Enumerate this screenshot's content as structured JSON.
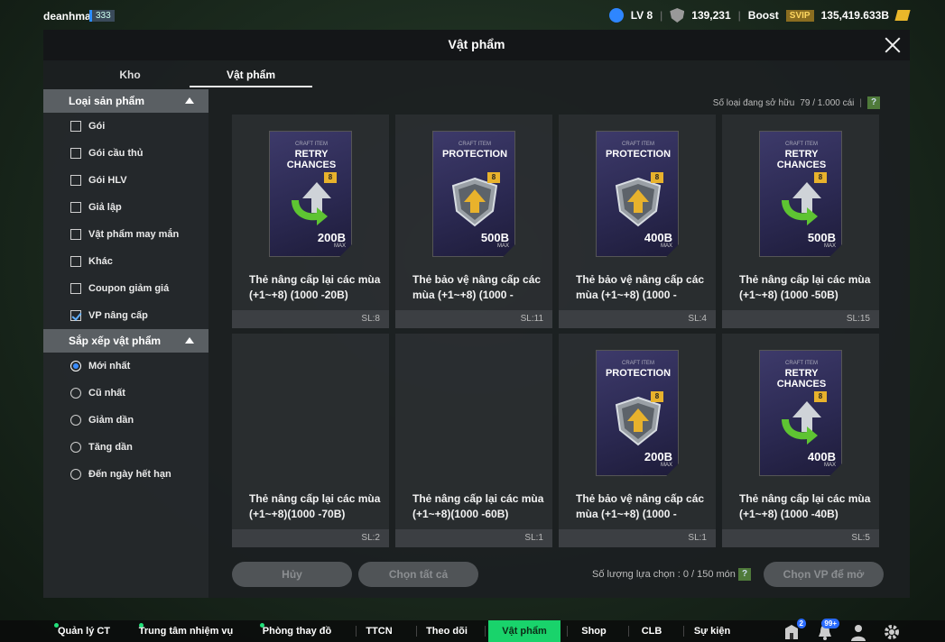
{
  "topbar": {
    "username": "deanhma",
    "user_badge": "333",
    "level": "LV 8",
    "shield_value": "139,231",
    "boost_label": "Boost",
    "svip_label": "SVIP",
    "bp_value": "135,419.633B"
  },
  "modal": {
    "title": "Vật phẩm",
    "tabs": [
      {
        "label": "Kho",
        "active": false
      },
      {
        "label": "Vật phẩm",
        "active": true
      }
    ]
  },
  "sidebar": {
    "product_type_header": "Loại sản phẩm",
    "filters": [
      {
        "label": "Gói",
        "checked": false
      },
      {
        "label": "Gói cầu thủ",
        "checked": false
      },
      {
        "label": "Gói HLV",
        "checked": false
      },
      {
        "label": "Giả lập",
        "checked": false
      },
      {
        "label": "Vật phẩm may mắn",
        "checked": false
      },
      {
        "label": "Khác",
        "checked": false
      },
      {
        "label": "Coupon giảm giá",
        "checked": false
      },
      {
        "label": "VP nâng cấp",
        "checked": true
      }
    ],
    "sort_header": "Sắp xếp vật phẩm",
    "sorts": [
      {
        "label": "Mới nhất",
        "selected": true
      },
      {
        "label": "Cũ nhất",
        "selected": false
      },
      {
        "label": "Giảm dần",
        "selected": false
      },
      {
        "label": "Tăng dần",
        "selected": false
      },
      {
        "label": "Đến ngày hết hạn",
        "selected": false
      }
    ]
  },
  "owned": {
    "label": "Số loại đang sở hữu",
    "value": "79 / 1.000 cái"
  },
  "items": [
    {
      "kind": "retry",
      "tag": "CRAFT ITEM",
      "title": "RETRY CHANCES",
      "level": "8",
      "value": "200B",
      "max": "MAX",
      "name": "Thẻ nâng cấp lại các mùa (+1~+8) (1000 -20B)",
      "qty": "SL:8",
      "show_card": true
    },
    {
      "kind": "protect",
      "tag": "CRAFT ITEM",
      "title": "PROTECTION",
      "level": "8",
      "value": "500B",
      "max": "MAX",
      "name": "Thẻ bảo vệ nâng cấp các mùa (+1~+8) (1000 -",
      "qty": "SL:11",
      "show_card": true
    },
    {
      "kind": "protect",
      "tag": "CRAFT ITEM",
      "title": "PROTECTION",
      "level": "8",
      "value": "400B",
      "max": "MAX",
      "name": "Thẻ bảo vệ nâng cấp các mùa (+1~+8) (1000 -",
      "qty": "SL:4",
      "show_card": true
    },
    {
      "kind": "retry",
      "tag": "CRAFT ITEM",
      "title": "RETRY CHANCES",
      "level": "8",
      "value": "500B",
      "max": "MAX",
      "name": "Thẻ nâng cấp lại các mùa (+1~+8) (1000 -50B)",
      "qty": "SL:15",
      "show_card": true
    },
    {
      "kind": "retry",
      "tag": "",
      "title": "",
      "level": "",
      "value": "",
      "max": "",
      "name": "Thẻ nâng cấp lại các mùa (+1~+8)(1000 -70B)",
      "qty": "SL:2",
      "show_card": false
    },
    {
      "kind": "retry",
      "tag": "",
      "title": "",
      "level": "",
      "value": "",
      "max": "",
      "name": "Thẻ nâng cấp lại các mùa (+1~+8)(1000 -60B)",
      "qty": "SL:1",
      "show_card": false
    },
    {
      "kind": "protect",
      "tag": "CRAFT ITEM",
      "title": "PROTECTION",
      "level": "8",
      "value": "200B",
      "max": "MAX",
      "name": "Thẻ bảo vệ nâng cấp các mùa (+1~+8) (1000 -",
      "qty": "SL:1",
      "show_card": true
    },
    {
      "kind": "retry",
      "tag": "CRAFT ITEM",
      "title": "RETRY CHANCES",
      "level": "8",
      "value": "400B",
      "max": "MAX",
      "name": "Thẻ nâng cấp lại các mùa (+1~+8) (1000 -40B)",
      "qty": "SL:5",
      "show_card": true
    }
  ],
  "footer": {
    "cancel_label": "Hủy",
    "select_all_label": "Chọn tất cả",
    "selection_label": "Số lượng lựa chọn : 0 / 150 món",
    "open_label": "Chọn VP để mở"
  },
  "bottom_nav": {
    "items": [
      {
        "label": "Quản lý CT",
        "dot": true,
        "active": false
      },
      {
        "label": "Trung tâm nhiệm vụ",
        "dot": true,
        "active": false
      },
      {
        "label": "Phòng thay đồ",
        "dot": true,
        "active": false
      },
      {
        "label": "TTCN",
        "dot": false,
        "active": false
      },
      {
        "label": "Theo dõi",
        "dot": false,
        "active": false
      },
      {
        "label": "Vật phẩm",
        "dot": false,
        "active": true
      },
      {
        "label": "Shop",
        "dot": false,
        "active": false
      },
      {
        "label": "CLB",
        "dot": false,
        "active": false
      },
      {
        "label": "Sự kiện",
        "dot": false,
        "active": false
      }
    ],
    "mail_badge": "2",
    "bell_badge": "99+"
  },
  "colors": {
    "accent_green": "#19d36b",
    "help_green": "#4f7a3a",
    "gold": "#e8b22c",
    "blue": "#3a8dff"
  }
}
